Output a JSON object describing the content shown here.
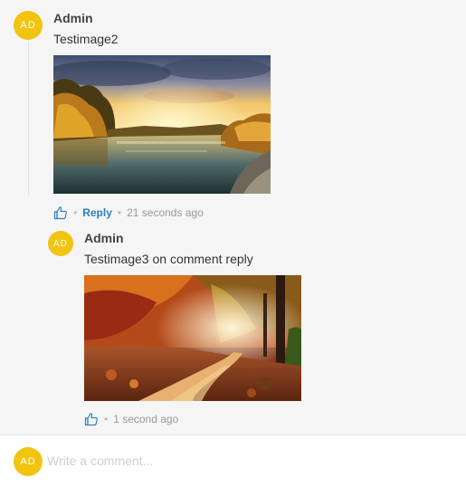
{
  "comment": {
    "avatar_initials": "AD",
    "author": "Admin",
    "text": "Testimage2",
    "image_description": "Autumn river landscape at sunset with golden trees",
    "reply_label": "Reply",
    "time": "21 seconds ago"
  },
  "reply": {
    "avatar_initials": "AD",
    "author": "Admin",
    "text": "Testimage3 on comment reply",
    "image_description": "Autumn forest path with red and orange foliage and sunlight",
    "time": "1 second ago"
  },
  "composer": {
    "avatar_initials": "AD",
    "placeholder": "Write a comment..."
  },
  "colors": {
    "avatar": "#f1c40f",
    "link": "#2f7fc1",
    "like_icon": "#2f7fc1"
  },
  "icons": {
    "like": "thumbs-up-icon"
  }
}
